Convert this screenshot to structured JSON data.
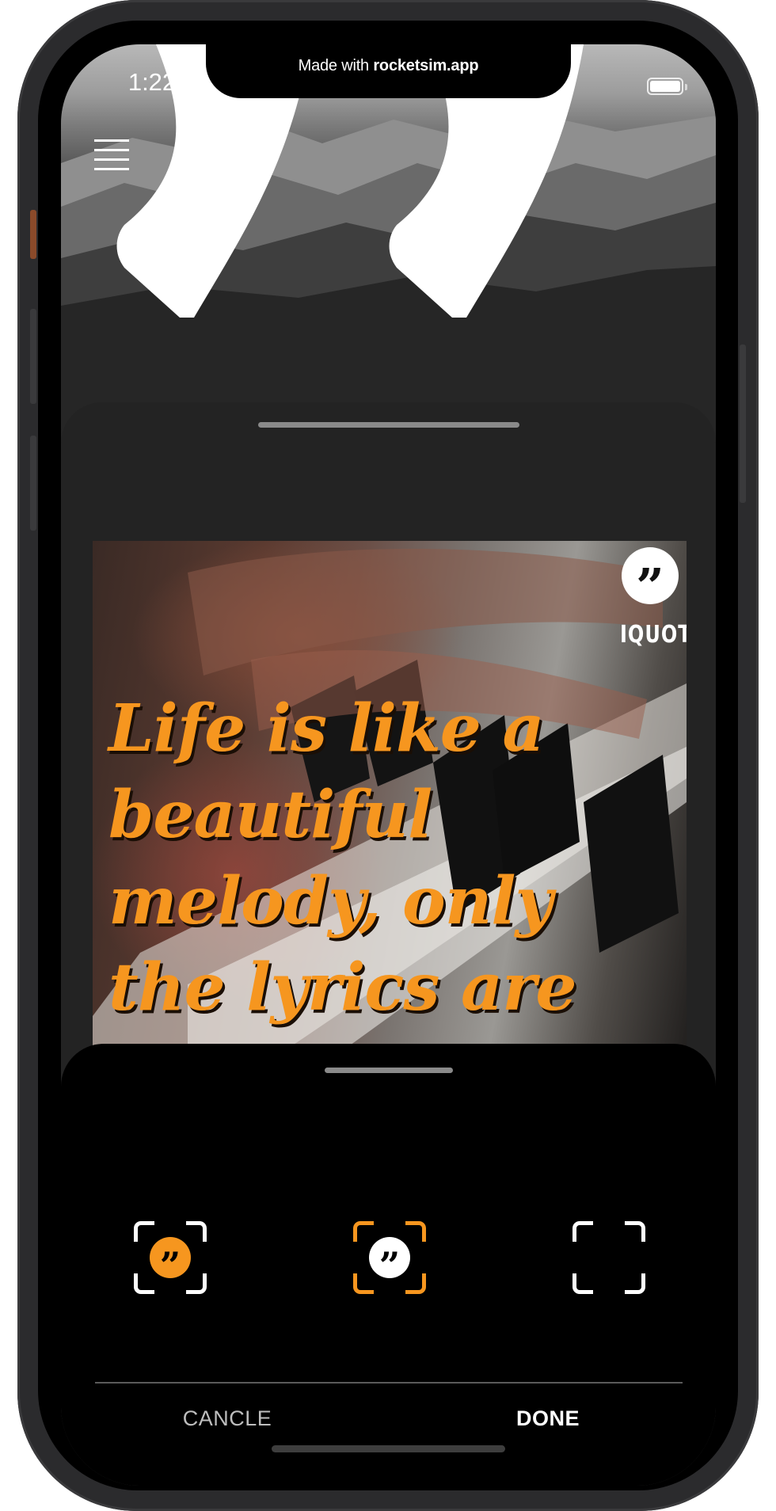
{
  "status_bar": {
    "time": "1:22",
    "banner_prefix": "Made with ",
    "banner_brand": "rocketsim.app"
  },
  "header": {
    "menu_icon": "hamburger-menu-icon",
    "decor_icon": "quote-mark-icon"
  },
  "card": {
    "quote_text": "Life is like a beautiful melody, only the lyrics are messed up.",
    "logo_glyph": "”",
    "logo_text": "IQUOTE",
    "quote_color": "#f6961f"
  },
  "style_options": [
    {
      "name": "logo-style-filled-orange",
      "glyph": "”",
      "frame_color": "#ffffff",
      "dot_bg": "#f6961f",
      "dot_fg": "#000000",
      "selected": false
    },
    {
      "name": "logo-style-white",
      "glyph": "”",
      "frame_color": "#f6961f",
      "dot_bg": "#ffffff",
      "dot_fg": "#000000",
      "selected": true
    },
    {
      "name": "logo-style-none",
      "glyph": "",
      "frame_color": "#ffffff",
      "dot_bg": "",
      "dot_fg": "",
      "selected": false
    }
  ],
  "actions": {
    "cancel_label": "CANCLE",
    "done_label": "DONE"
  },
  "colors": {
    "accent": "#f6961f",
    "panel_bg": "#000000",
    "sheet_bg": "#232323"
  }
}
